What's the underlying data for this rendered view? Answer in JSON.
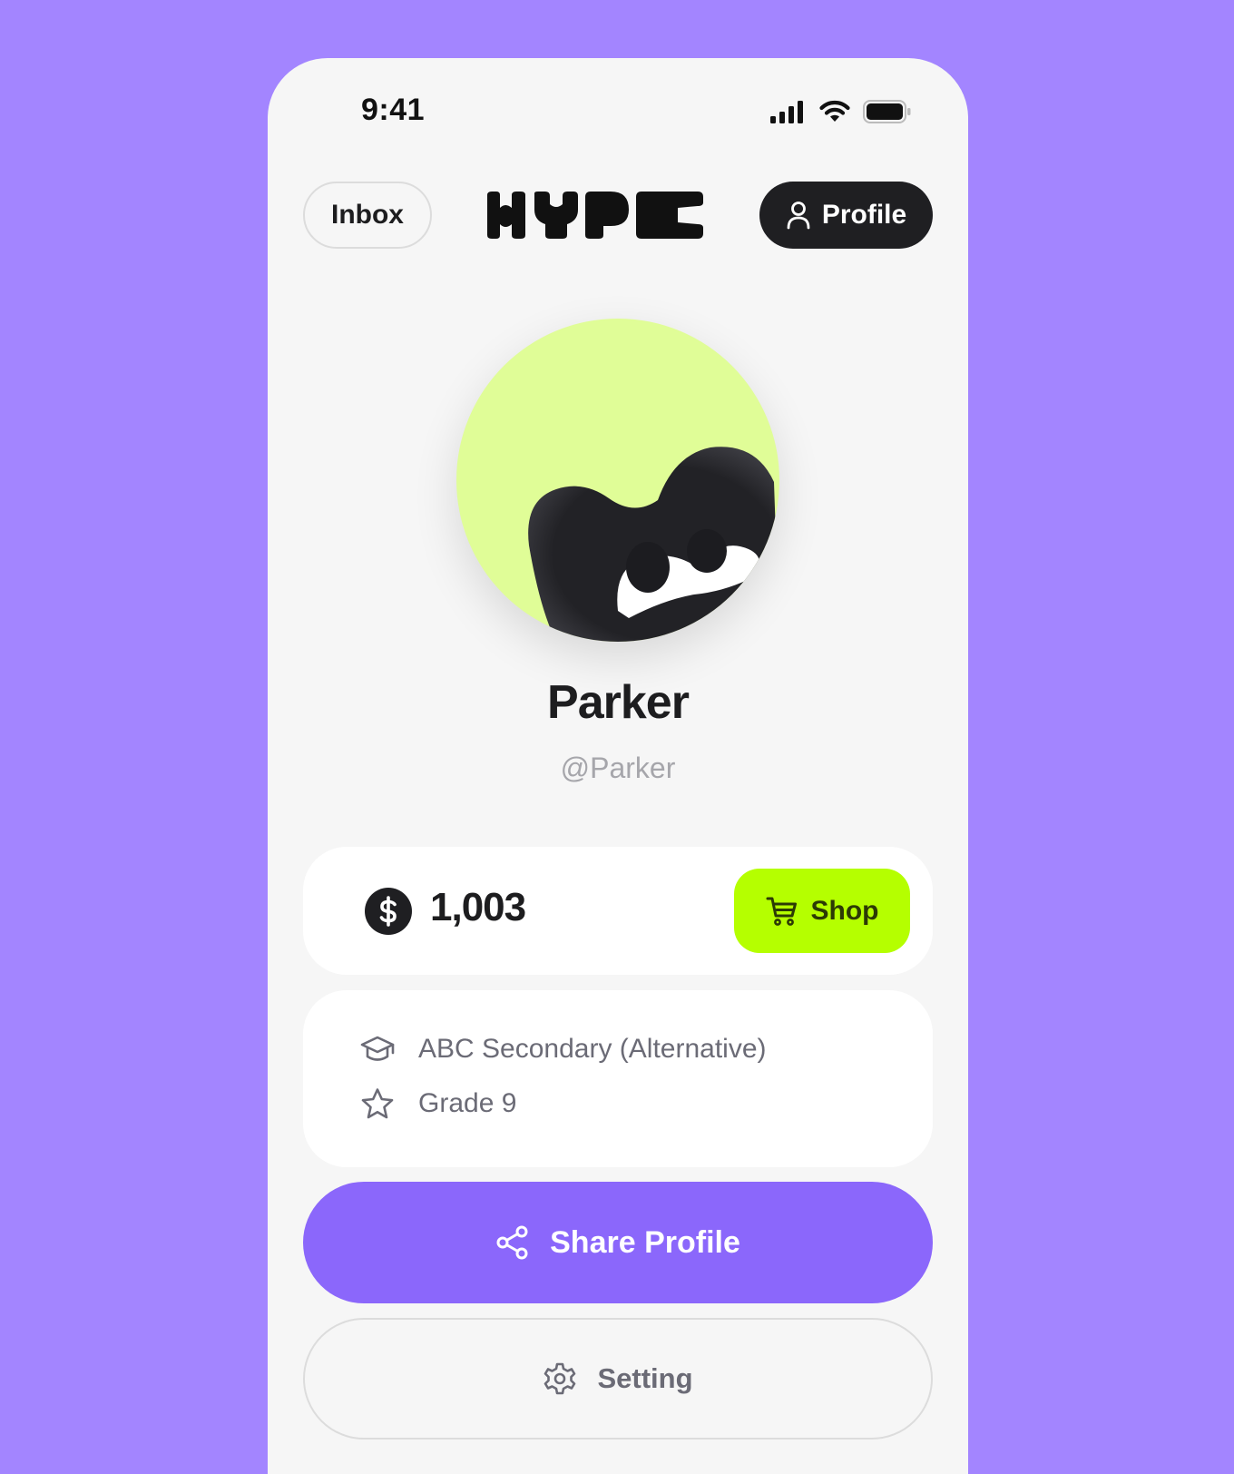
{
  "status_bar": {
    "time": "9:41"
  },
  "header": {
    "inbox_label": "Inbox",
    "logo_text": "HYPE",
    "profile_label": "Profile"
  },
  "user": {
    "display_name": "Parker",
    "username": "@Parker"
  },
  "wallet": {
    "coin_count": "1,003",
    "shop_label": "Shop"
  },
  "info": {
    "school": "ABC Secondary (Alternative)",
    "grade": "Grade 9"
  },
  "actions": {
    "share_label": "Share Profile",
    "setting_label": "Setting"
  },
  "colors": {
    "background": "#a385ff",
    "screen": "#f6f6f6",
    "avatar_bg": "#e0fd97",
    "shop": "#b5ff00",
    "share": "#8b67fb",
    "dark": "#1f1f22"
  }
}
